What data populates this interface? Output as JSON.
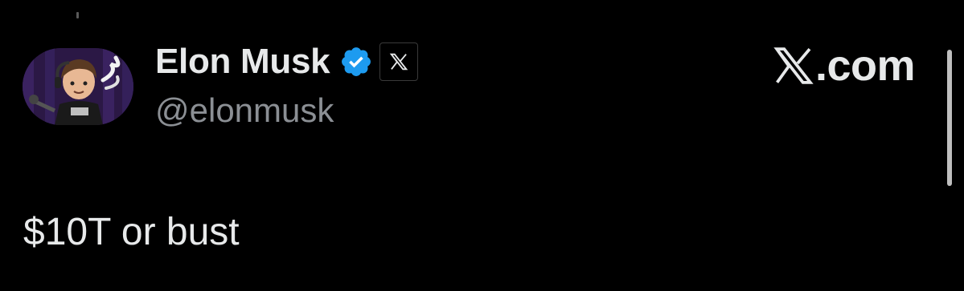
{
  "author": {
    "display_name": "Elon Musk",
    "handle": "@elonmusk",
    "verified_icon": "verified-badge-icon",
    "affiliate_icon": "x-logo-icon",
    "avatar": "avatar-image"
  },
  "site": {
    "label": ".com",
    "logo_icon": "x-logo-icon"
  },
  "post": {
    "text": "$10T or bust"
  },
  "colors": {
    "background": "#000000",
    "primary_text": "#e7e9ea",
    "secondary_text": "#8b8f94",
    "verified_blue": "#1d9bf0"
  }
}
